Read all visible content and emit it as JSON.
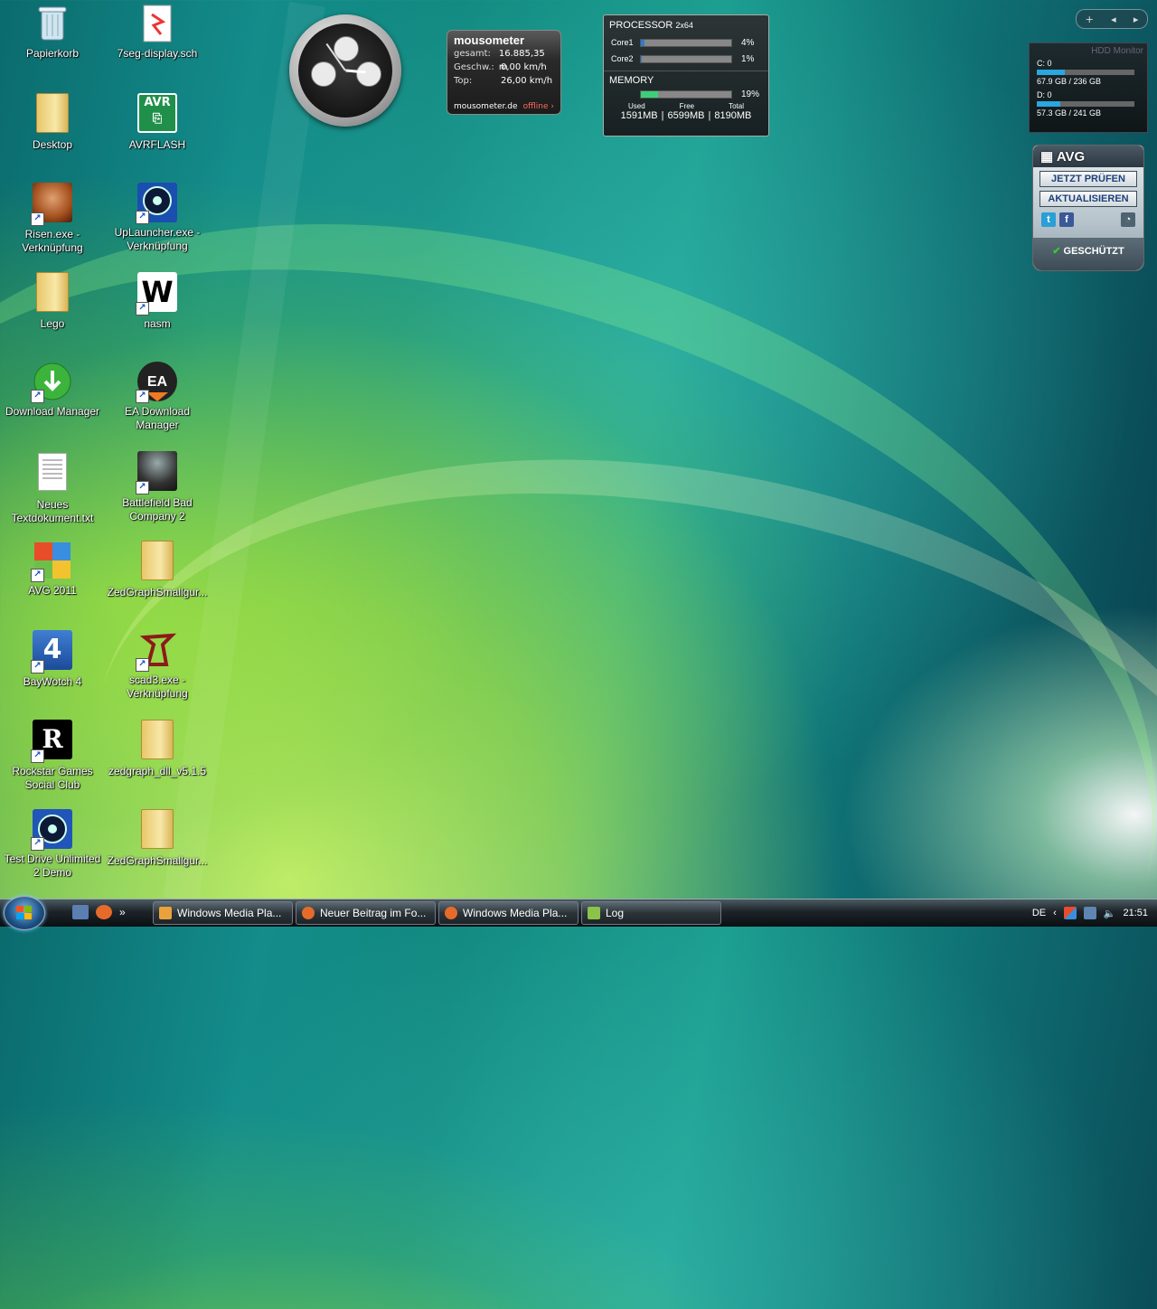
{
  "desktop": {
    "icons_col1": [
      {
        "label": "Papierkorb",
        "kind": "recycle-bin"
      },
      {
        "label": "Desktop",
        "kind": "folder"
      },
      {
        "label": "Risen.exe - Verknüpfung",
        "kind": "app"
      },
      {
        "label": "Lego",
        "kind": "folder"
      },
      {
        "label": "Download Manager",
        "kind": "app"
      },
      {
        "label": "Neues Textdokument.txt",
        "kind": "text-file"
      },
      {
        "label": "AVG 2011",
        "kind": "app"
      },
      {
        "label": "BayWotch 4",
        "kind": "app"
      },
      {
        "label": "Rockstar Games Social Club",
        "kind": "app"
      },
      {
        "label": "Test Drive Unlimited 2 Demo",
        "kind": "app"
      }
    ],
    "icons_col2": [
      {
        "label": "7seg-display.sch",
        "kind": "file"
      },
      {
        "label": "AVRFLASH",
        "kind": "app"
      },
      {
        "label": "UpLauncher.exe - Verknüpfung",
        "kind": "app"
      },
      {
        "label": "nasm",
        "kind": "app"
      },
      {
        "label": "EA Download Manager",
        "kind": "app"
      },
      {
        "label": "Battlefield Bad Company 2",
        "kind": "app"
      },
      {
        "label": "ZedGraphSmallgur...",
        "kind": "folder"
      },
      {
        "label": "scad3.exe - Verknüpfung",
        "kind": "app"
      },
      {
        "label": "zedgraph_dll_v5.1.5",
        "kind": "folder"
      },
      {
        "label": "ZedGraphSmallgur...",
        "kind": "folder"
      }
    ]
  },
  "gadgets": {
    "mousometer": {
      "title": "mousometer",
      "rows": [
        {
          "key": "gesamt:",
          "value": "16.885,35 m"
        },
        {
          "key": "Geschw.:",
          "value": "0,00 km/h"
        },
        {
          "key": "Top:",
          "value": "26,00 km/h"
        }
      ],
      "site": "mousometer.de",
      "status": "offline ›"
    },
    "cpu": {
      "title": "PROCESSOR",
      "subtitle": "2x64",
      "cores": [
        {
          "name": "Core1",
          "percent": 4,
          "label": "4%"
        },
        {
          "name": "Core2",
          "percent": 1,
          "label": "1%"
        }
      ],
      "memory_title": "MEMORY",
      "memory_percent": 19,
      "memory_label": "19%",
      "memory_headers": [
        "Used",
        "Free",
        "Total"
      ],
      "memory_values": [
        "1591MB",
        "|",
        "6599MB",
        "|",
        "8190MB"
      ]
    },
    "hdd": {
      "title": "HDD Monitor",
      "drives": [
        {
          "name": "C: 0",
          "usage": "67.9 GB / 236 GB",
          "fraction": 0.29
        },
        {
          "name": "D: 0",
          "usage": "57.3 GB / 241 GB",
          "fraction": 0.24
        }
      ]
    },
    "avg": {
      "brand": "AVG",
      "scan_button": "JETZT PRÜFEN",
      "update_button": "AKTUALISIEREN",
      "status": "GESCHÜTZT"
    },
    "sidebar_controls": {
      "add": "+",
      "prev": "◂",
      "next": "▸"
    }
  },
  "taskbar": {
    "tasks": [
      {
        "label": "Windows Media Pla...",
        "icon": "media-player-icon",
        "color": "#e9a23b"
      },
      {
        "label": "Neuer Beitrag im Fo...",
        "icon": "firefox-icon",
        "color": "#e66b2a"
      },
      {
        "label": "Windows Media Pla...",
        "icon": "firefox-icon",
        "color": "#e66b2a"
      },
      {
        "label": "Log",
        "icon": "notepad-icon",
        "color": "#8bc34a"
      }
    ],
    "language": "DE",
    "time": "21:51",
    "quick_launch_more": "»"
  }
}
